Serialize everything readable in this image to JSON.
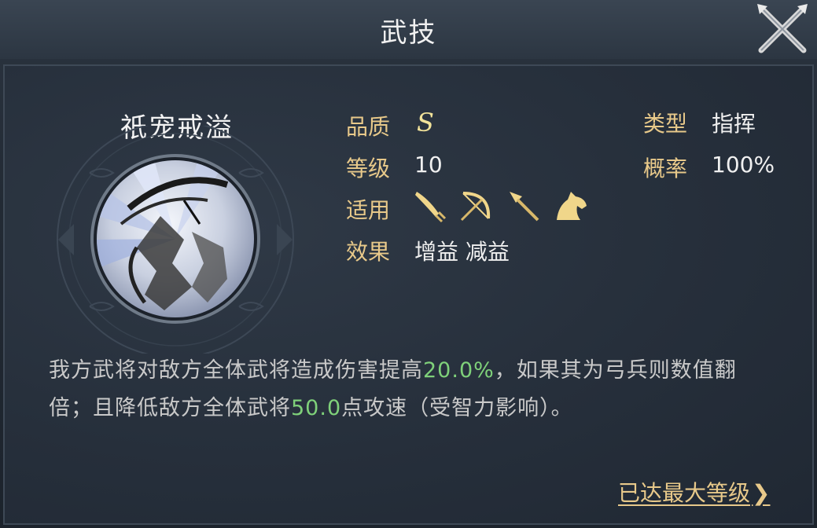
{
  "header": {
    "title": "武技"
  },
  "skill": {
    "name": "祇宠戒溢",
    "quality_label": "品质",
    "quality_value": "S",
    "level_label": "等级",
    "level_value": "10",
    "applies_label": "适用",
    "applies_icons": [
      "sword-icon",
      "bow-icon",
      "spear-icon",
      "horse-icon"
    ],
    "effect_label": "效果",
    "effect_value": "增益 减益",
    "type_label": "类型",
    "type_value": "指挥",
    "chance_label": "概率",
    "chance_value": "100%"
  },
  "description": {
    "part1": "我方武将对敌方全体武将造成伤害提高",
    "highlight1": "20.0%",
    "part2": "，如果其为弓兵则数值翻倍；且降低敌方全体武将",
    "highlight2": "50.0",
    "part3": "点攻速（受智力影响）。"
  },
  "footer": {
    "max_level_label": "已达最大等级",
    "chevron": "❯"
  },
  "colors": {
    "label_gold": "#e8c98a",
    "highlight_green": "#7fd17a",
    "background": "#262f3b"
  }
}
